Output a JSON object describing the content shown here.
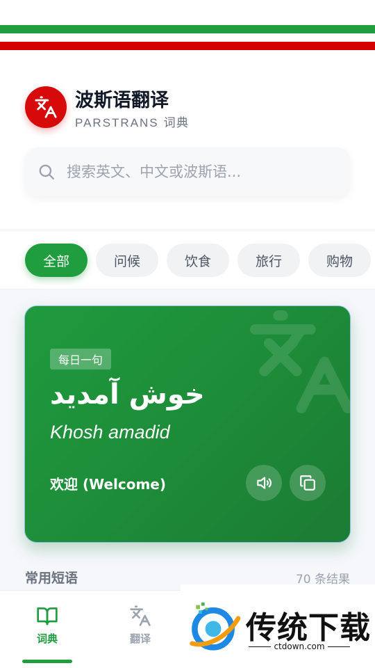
{
  "app": {
    "title": "波斯语翻译",
    "subtitle_en": "PARSTRANS",
    "subtitle_cn": "词典"
  },
  "search": {
    "placeholder": "搜索英文、中文或波斯语...",
    "value": ""
  },
  "categories": [
    {
      "label": "全部",
      "active": true
    },
    {
      "label": "问候",
      "active": false
    },
    {
      "label": "饮食",
      "active": false
    },
    {
      "label": "旅行",
      "active": false
    },
    {
      "label": "购物",
      "active": false
    }
  ],
  "daily": {
    "badge": "每日一句",
    "farsi": "خوش آمدید",
    "transliteration": "Khosh amadid",
    "meaning": "欢迎 (Welcome)"
  },
  "section": {
    "title": "常用短语",
    "count": "70 条结果"
  },
  "nav": {
    "items": [
      {
        "label": "词典",
        "active": true,
        "icon": "book-icon"
      },
      {
        "label": "翻译",
        "active": false,
        "icon": "translate-icon"
      }
    ]
  },
  "watermark": {
    "brand": "传统下载",
    "domain": "ctdown.com"
  },
  "colors": {
    "primary": "#1f9d3f",
    "flag_green": "#1f9d3f",
    "flag_red": "#d50000",
    "logo_red": "#d60a0a"
  }
}
